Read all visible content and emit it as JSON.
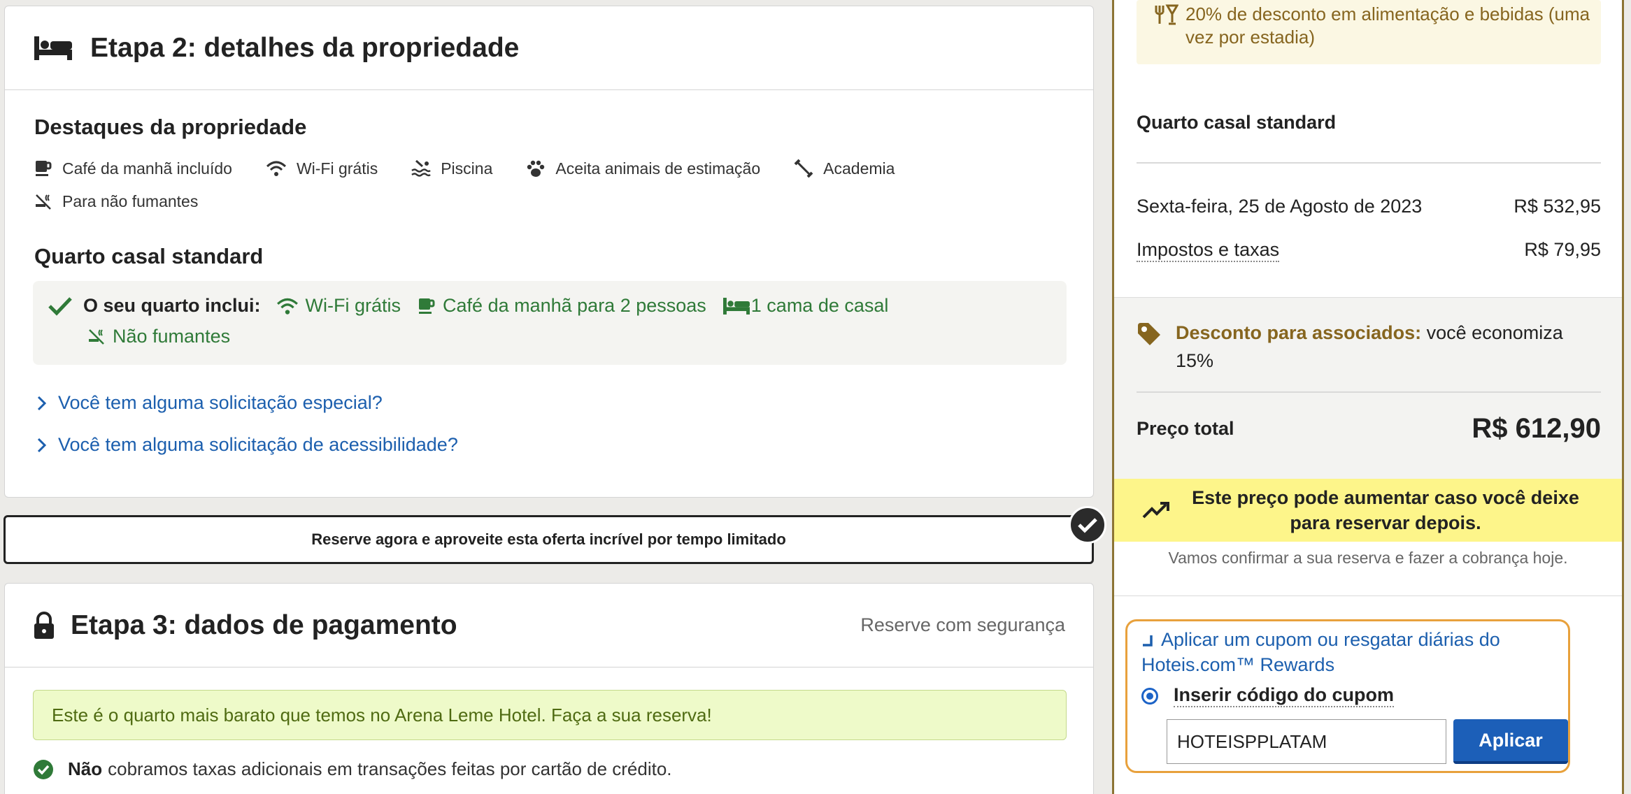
{
  "step2": {
    "title": "Etapa 2: detalhes da propriedade",
    "highlights_title": "Destaques da propriedade",
    "highlights": [
      {
        "icon": "coffee-icon",
        "label": "Café da manhã incluído"
      },
      {
        "icon": "wifi-icon",
        "label": "Wi-Fi grátis"
      },
      {
        "icon": "pool-icon",
        "label": "Piscina"
      },
      {
        "icon": "paw-icon",
        "label": "Aceita animais de estimação"
      },
      {
        "icon": "dumbbell-icon",
        "label": "Academia"
      },
      {
        "icon": "no-smoking-icon",
        "label": "Para não fumantes"
      }
    ],
    "room_title": "Quarto casal standard",
    "includes_label": "O seu quarto inclui:",
    "includes": [
      {
        "icon": "wifi-icon",
        "label": "Wi-Fi grátis"
      },
      {
        "icon": "coffee-icon",
        "label": "Café da manhã para 2 pessoas"
      },
      {
        "icon": "bed-icon",
        "label": "1 cama de casal"
      },
      {
        "icon": "no-smoking-icon",
        "label": "Não fumantes"
      }
    ],
    "special_request": "Você tem alguma solicitação especial?",
    "accessibility_request": "Você tem alguma solicitação de acessibilidade?"
  },
  "promo_banner": "Reserve agora e aproveite esta oferta incrível por tempo limitado",
  "step3": {
    "title": "Etapa 3: dados de pagamento",
    "secure": "Reserve com segurança",
    "cheapest_notice": "Este é o quarto mais barato que temos no Arena Leme Hotel. Faça a sua reserva!",
    "fee_bold": "Não",
    "fee_text": "cobramos taxas adicionais em transações feitas por cartão de crédito."
  },
  "summary": {
    "food_discount": "20% de desconto em alimentação e bebidas (uma vez por estadia)",
    "room_name": "Quarto casal standard",
    "night_date": "Sexta-feira, 25 de Agosto de 2023",
    "night_price": "R$ 532,95",
    "taxes_label": "Impostos e taxas",
    "taxes_price": "R$ 79,95",
    "member_bold": "Desconto para associados:",
    "member_text": "você economiza 15%",
    "total_label": "Preço total",
    "total_value": "R$ 612,90",
    "price_warning": "Este preço pode aumentar caso você deixe para reservar depois.",
    "confirm_text": "Vamos confirmar a sua reserva e fazer a cobrança hoje.",
    "coupon_link": "Aplicar um cupom ou resgatar diárias do Hoteis.com™ Rewards",
    "coupon_radio": "Inserir código do cupom",
    "coupon_value": "HOTEISPPLATAM",
    "apply_label": "Aplicar"
  },
  "colors": {
    "link": "#1c5fae",
    "green": "#2f7a38",
    "gold": "#86651f",
    "apply": "#1c5fb8",
    "warning_yellow": "#fdf58a"
  }
}
